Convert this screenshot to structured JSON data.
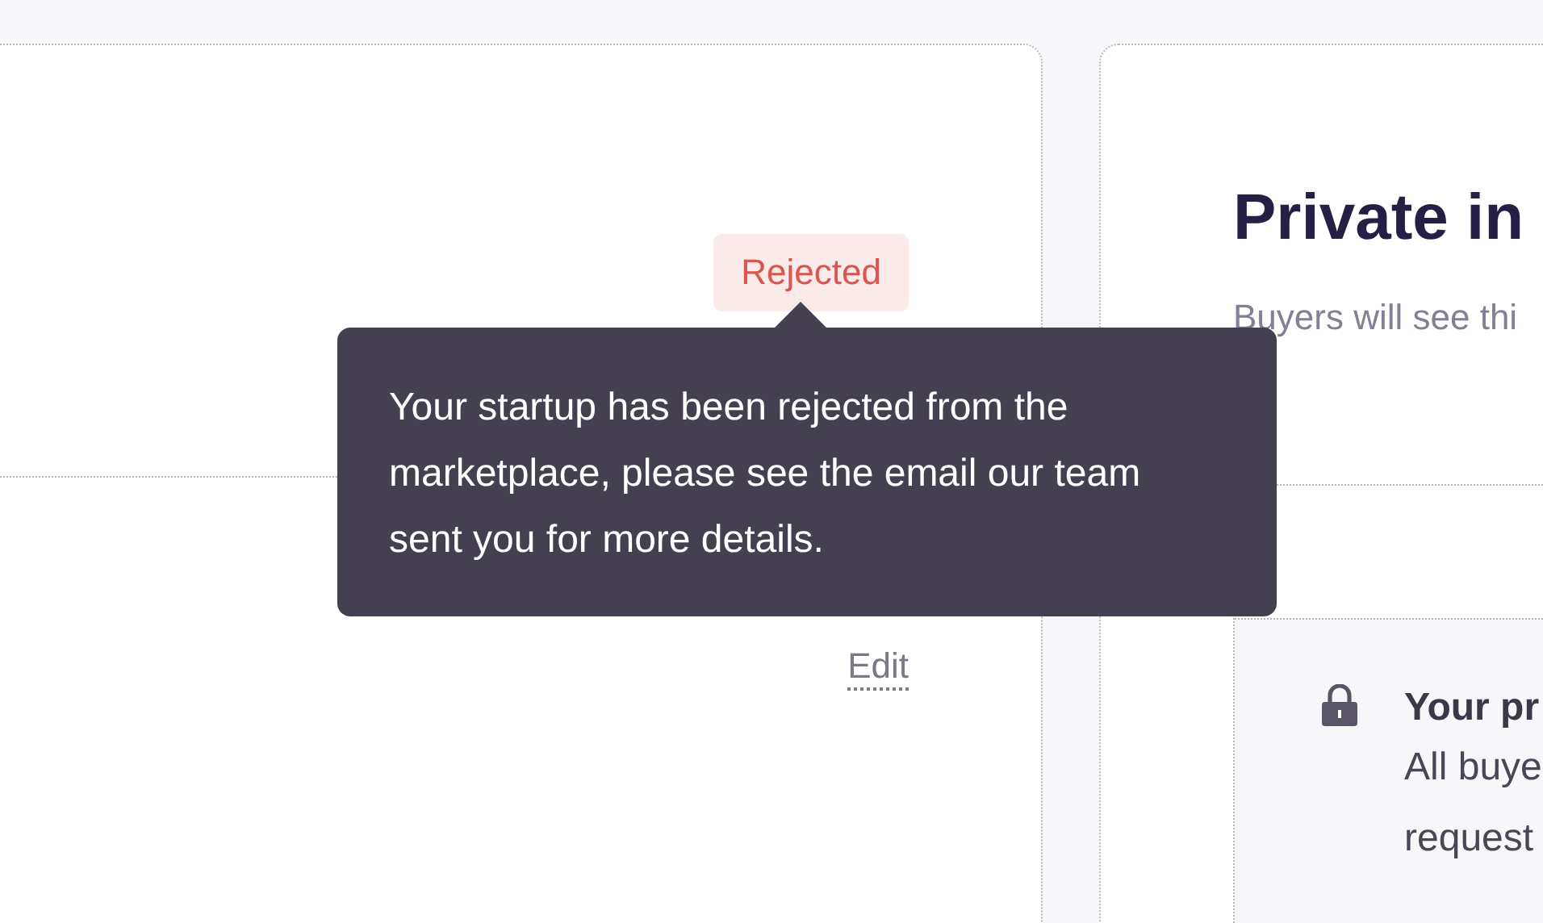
{
  "left_card": {
    "status_badge": "Rejected",
    "tooltip": "Your startup has been rejected from the marketplace, please see the email our team sent you for more details.",
    "edit_link": "Edit"
  },
  "right_card": {
    "title": "Private in",
    "subtitle": "Buyers will see thi",
    "notice": {
      "title": "Your pr",
      "lines": [
        "All buye",
        "request"
      ]
    }
  }
}
